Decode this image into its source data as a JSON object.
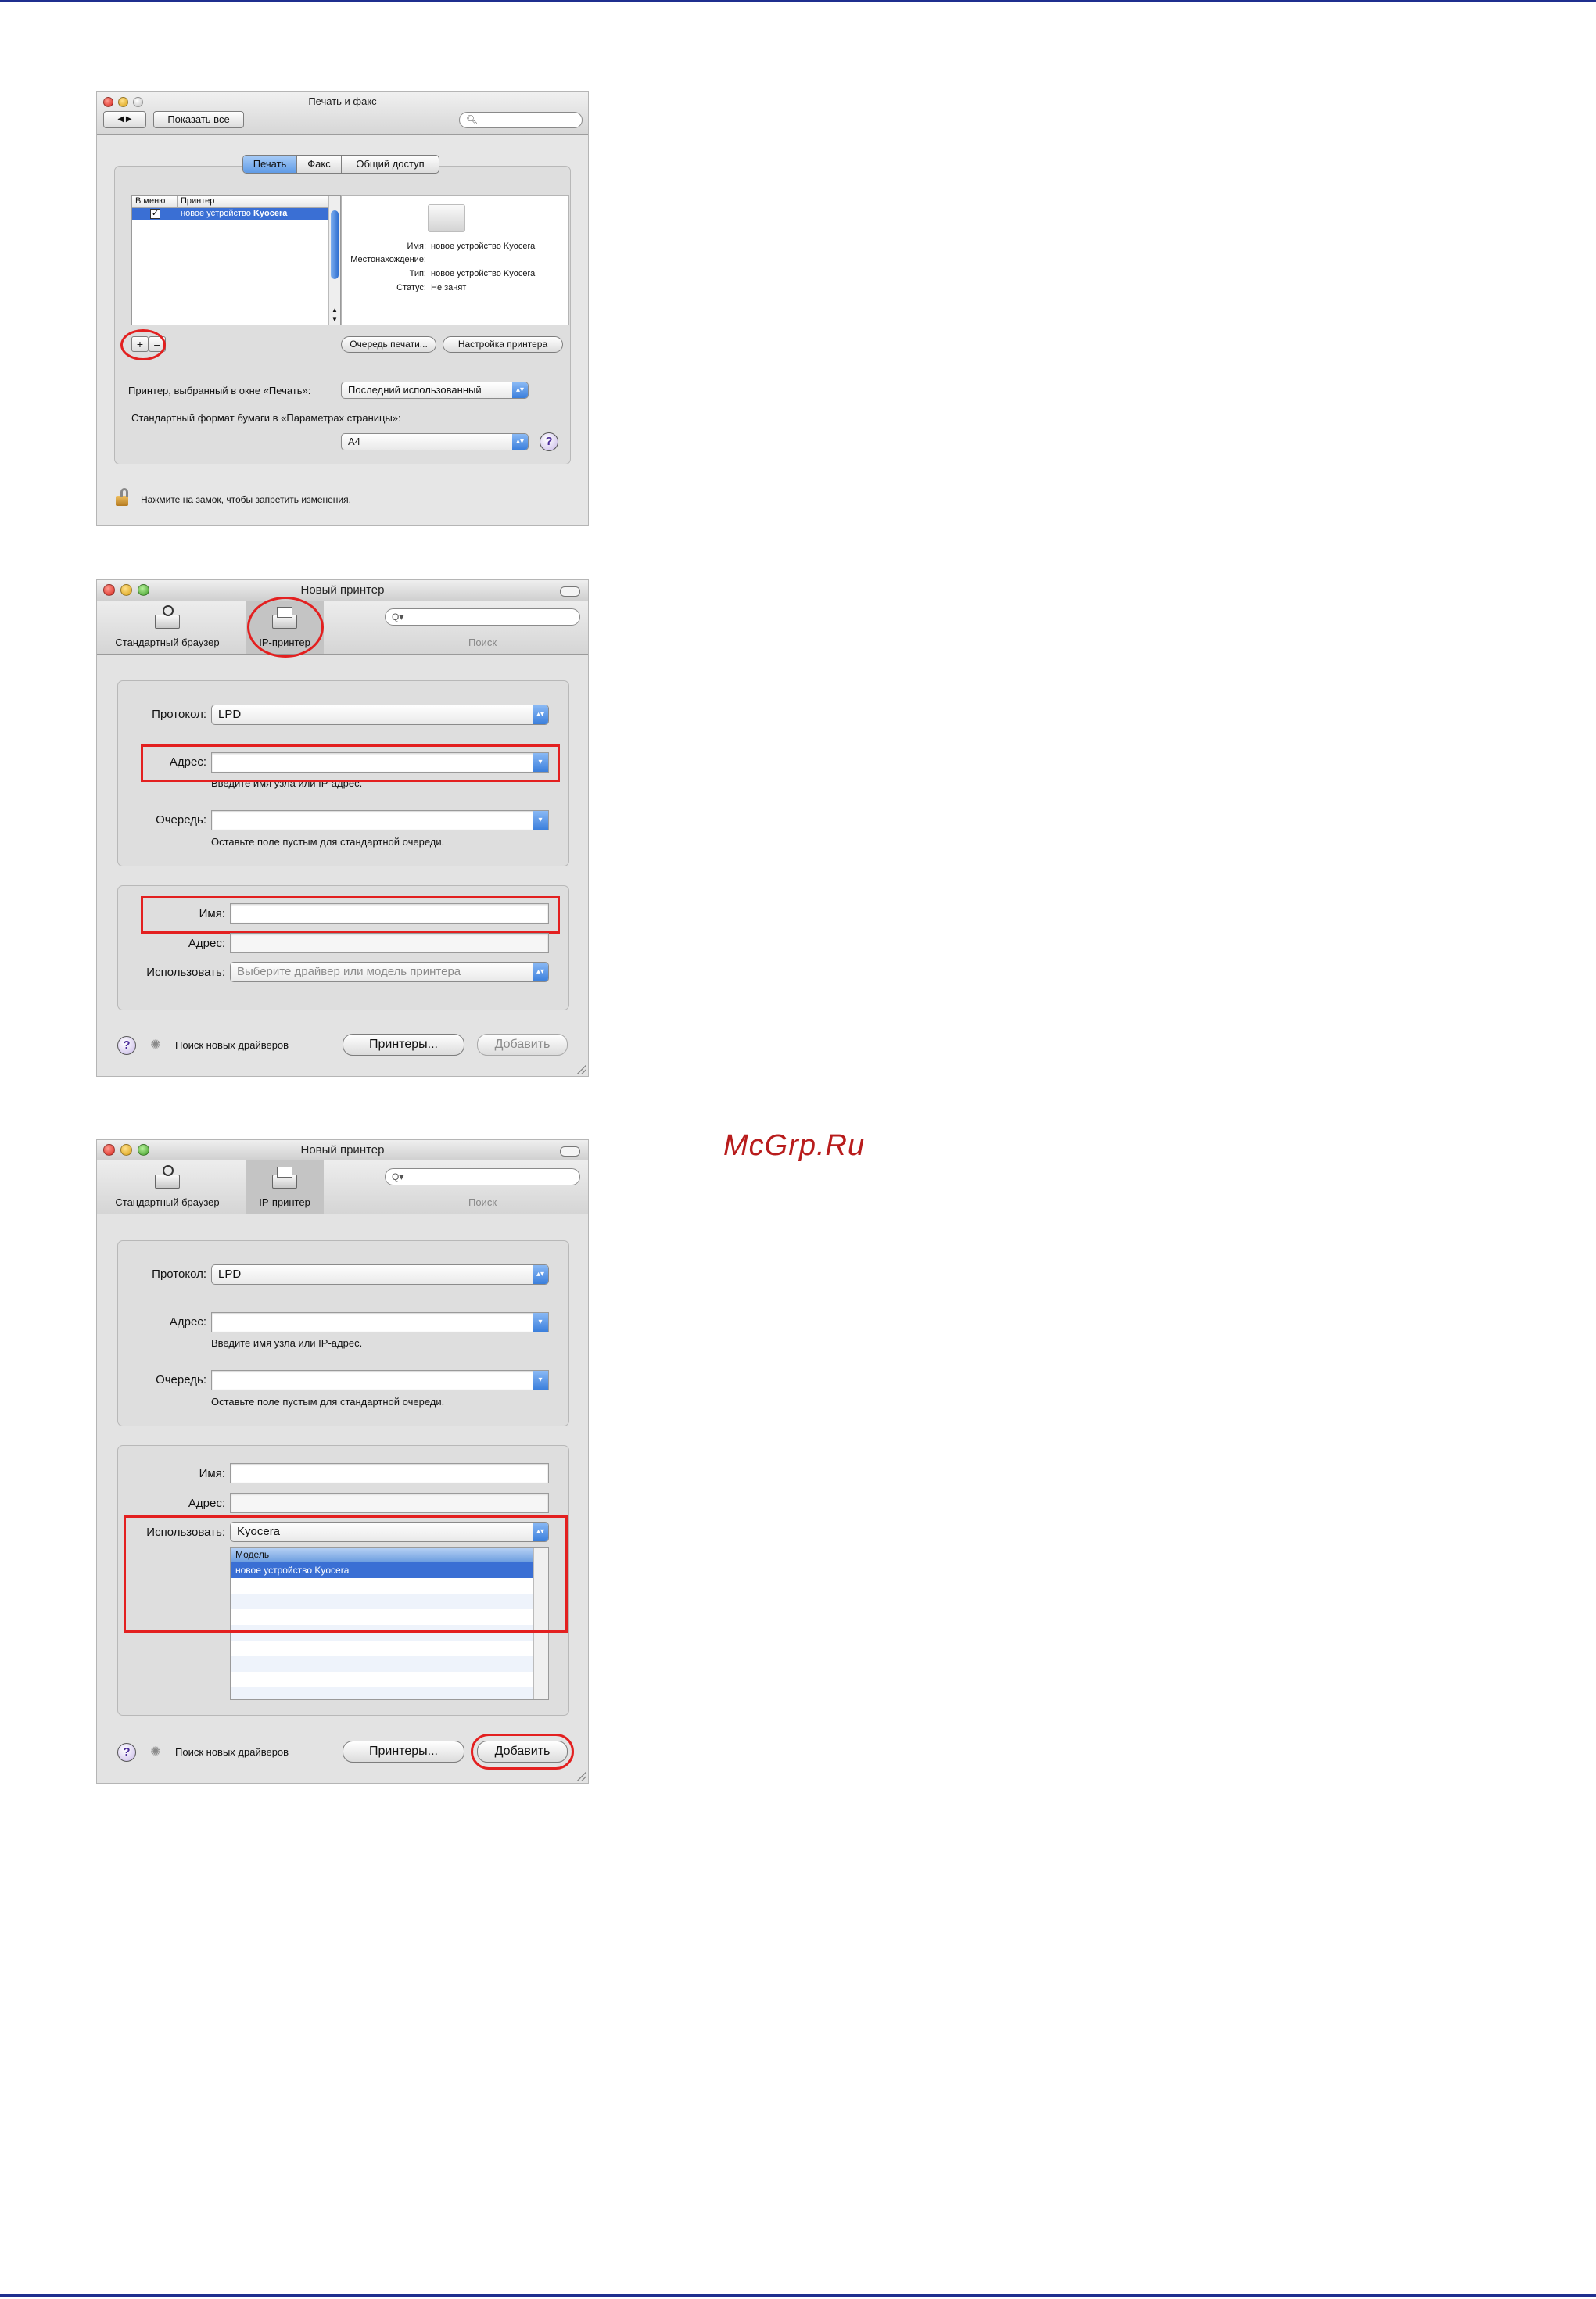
{
  "watermark": "McGrp.Ru",
  "window1": {
    "title": "Печать и факс",
    "show_all": "Показать все",
    "nav_arrows": "◀ ▶",
    "tabs": [
      {
        "label": "Печать",
        "selected": true
      },
      {
        "label": "Факс",
        "selected": false
      },
      {
        "label": "Общий доступ",
        "selected": false
      }
    ],
    "list_headers": {
      "in_menu": "В меню",
      "printer": "Принтер"
    },
    "list_row": {
      "checked": true,
      "name_prefix": "новое устройство ",
      "name_bold": "Kyocera"
    },
    "details": {
      "name_label": "Имя:",
      "name_value": "новое устройство Kyocera",
      "location_label": "Местонахождение:",
      "location_value": "",
      "type_label": "Тип:",
      "type_value": "новое устройство Kyocera",
      "status_label": "Статус:",
      "status_value": "Не занят"
    },
    "add": "+",
    "remove": "–",
    "print_queue": "Очередь печати...",
    "printer_setup": "Настройка принтера",
    "selected_printer_label": "Принтер, выбранный в окне «Печать»:",
    "selected_printer_value": "Последний использованный",
    "paper_label": "Стандартный формат бумаги в «Параметрах страницы»:",
    "paper_value": "A4",
    "lock_text": "Нажмите на замок, чтобы запретить изменения."
  },
  "window2": {
    "title": "Новый принтер",
    "toolbar": {
      "default_browser": "Стандартный браузер",
      "ip_printer": "IP-принтер",
      "search": "Поиск",
      "search_placeholder": "Q▾"
    },
    "protocol_label": "Протокол:",
    "protocol_value": "LPD",
    "address_label": "Адрес:",
    "address_value": "",
    "address_hint": "Введите имя узла или IP-адрес.",
    "queue_label": "Очередь:",
    "queue_value": "",
    "queue_hint": "Оставьте поле пустым для стандартной очереди.",
    "name_label": "Имя:",
    "name_value": "",
    "address2_label": "Адрес:",
    "address2_value": "",
    "use_label": "Использовать:",
    "use_value": "Выберите драйвер или модель принтера",
    "driver_search": "Поиск новых драйверов",
    "printers_button": "Принтеры...",
    "add_button": "Добавить"
  },
  "window3": {
    "title": "Новый принтер",
    "toolbar": {
      "default_browser": "Стандартный браузер",
      "ip_printer": "IP-принтер",
      "search": "Поиск",
      "search_placeholder": "Q▾"
    },
    "protocol_label": "Протокол:",
    "protocol_value": "LPD",
    "address_label": "Адрес:",
    "address_value": "",
    "address_hint": "Введите имя узла или IP-адрес.",
    "queue_label": "Очередь:",
    "queue_value": "",
    "queue_hint": "Оставьте поле пустым для стандартной очереди.",
    "name_label": "Имя:",
    "name_value": "",
    "address2_label": "Адрес:",
    "address2_value": "",
    "use_label": "Использовать:",
    "use_value": "Kyocera",
    "model_header": "Модель",
    "models": [
      "новое устройство Kyocera"
    ],
    "driver_search": "Поиск новых драйверов",
    "printers_button": "Принтеры...",
    "add_button": "Добавить"
  },
  "colors": {
    "annotation": "#e32020",
    "selection": "#3a6fd4",
    "rule": "#1f2f8f",
    "watermark": "#b81c1c"
  }
}
